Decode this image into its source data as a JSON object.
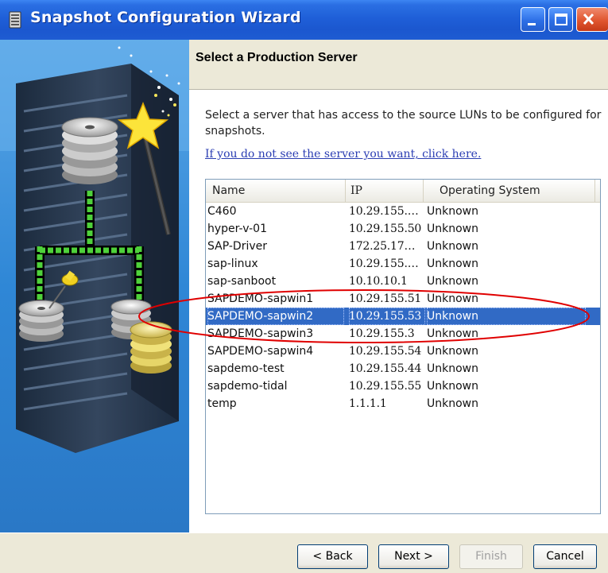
{
  "window": {
    "title": "Snapshot Configuration Wizard"
  },
  "page": {
    "title": "Select a Production Server",
    "instructions": "Select a server that has access to the source LUNs to be configured for snapshots.",
    "help_link": "If you do not see the server you want, click here."
  },
  "table": {
    "columns": [
      "Name",
      "IP",
      "Operating System"
    ],
    "rows": [
      {
        "name": "C460",
        "ip": "10.29.155.…",
        "os": "Unknown"
      },
      {
        "name": "hyper-v-01",
        "ip": "10.29.155.50",
        "os": "Unknown"
      },
      {
        "name": "SAP-Driver",
        "ip": "172.25.17…",
        "os": "Unknown"
      },
      {
        "name": "sap-linux",
        "ip": "10.29.155.…",
        "os": "Unknown"
      },
      {
        "name": "sap-sanboot",
        "ip": "10.10.10.1",
        "os": "Unknown"
      },
      {
        "name": "SAPDEMO-sapwin1",
        "ip": "10.29.155.51",
        "os": "Unknown"
      },
      {
        "name": "SAPDEMO-sapwin2",
        "ip": "10.29.155.53",
        "os": "Unknown"
      },
      {
        "name": "SAPDEMO-sapwin3",
        "ip": "10.29.155.3",
        "os": "Unknown"
      },
      {
        "name": "SAPDEMO-sapwin4",
        "ip": "10.29.155.54",
        "os": "Unknown"
      },
      {
        "name": "sapdemo-test",
        "ip": "10.29.155.44",
        "os": "Unknown"
      },
      {
        "name": "sapdemo-tidal",
        "ip": "10.29.155.55",
        "os": "Unknown"
      },
      {
        "name": "temp",
        "ip": "1.1.1.1",
        "os": "Unknown"
      }
    ],
    "selected_index": 6
  },
  "buttons": {
    "back": "< Back",
    "next": "Next >",
    "finish": "Finish",
    "cancel": "Cancel"
  },
  "colors": {
    "titlebar": "#1f5fd8",
    "selection": "#316ac5",
    "annotation": "#e00000",
    "art_background": "#2f87d6"
  },
  "icons": [
    "app-icon",
    "minimize-icon",
    "maximize-icon",
    "close-icon",
    "wizard-wand-icon",
    "pushpin-icon"
  ]
}
